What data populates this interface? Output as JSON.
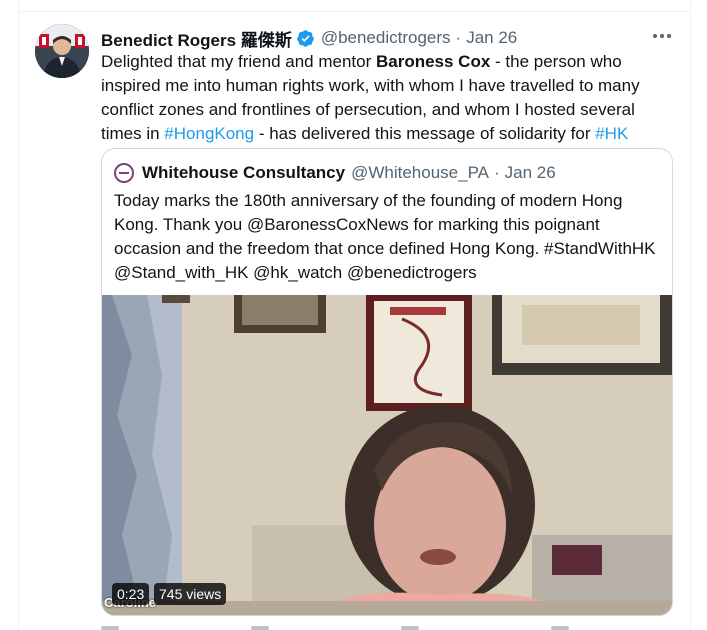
{
  "tweet": {
    "display_name": "Benedict Rogers 羅傑斯",
    "handle": "@benedictrogers",
    "separator": "·",
    "date": "Jan 26",
    "text": {
      "part1": "Delighted that my friend and mentor ",
      "bold": "Baroness Cox",
      "part2": " - the person who inspired me into human rights work, with whom I have travelled to many conflict zones and frontlines of persecution, and whom I hosted several times in ",
      "link1": "#HongKong",
      "part3": " - has delivered this message of solidarity for ",
      "link2": "#HK"
    }
  },
  "quote": {
    "display_name": "Whitehouse Consultancy",
    "handle": "@Whitehouse_PA",
    "separator": "·",
    "date": "Jan 26",
    "text": "Today marks the 180th anniversary of the founding of modern Hong Kong. Thank you @BaronessCoxNews for marking this poignant occasion and the freedom that once defined Hong Kong. #StandWithHK @Stand_with_HK @hk_watch @benedictrogers"
  },
  "video": {
    "duration": "0:23",
    "views": "745 views",
    "caption": "Caroline"
  },
  "colors": {
    "accent": "#1d9bf0",
    "text": "#0f1419",
    "secondary": "#536471",
    "border": "#cfd9de"
  },
  "icons": [
    "verified-badge-icon",
    "more-options-icon"
  ]
}
